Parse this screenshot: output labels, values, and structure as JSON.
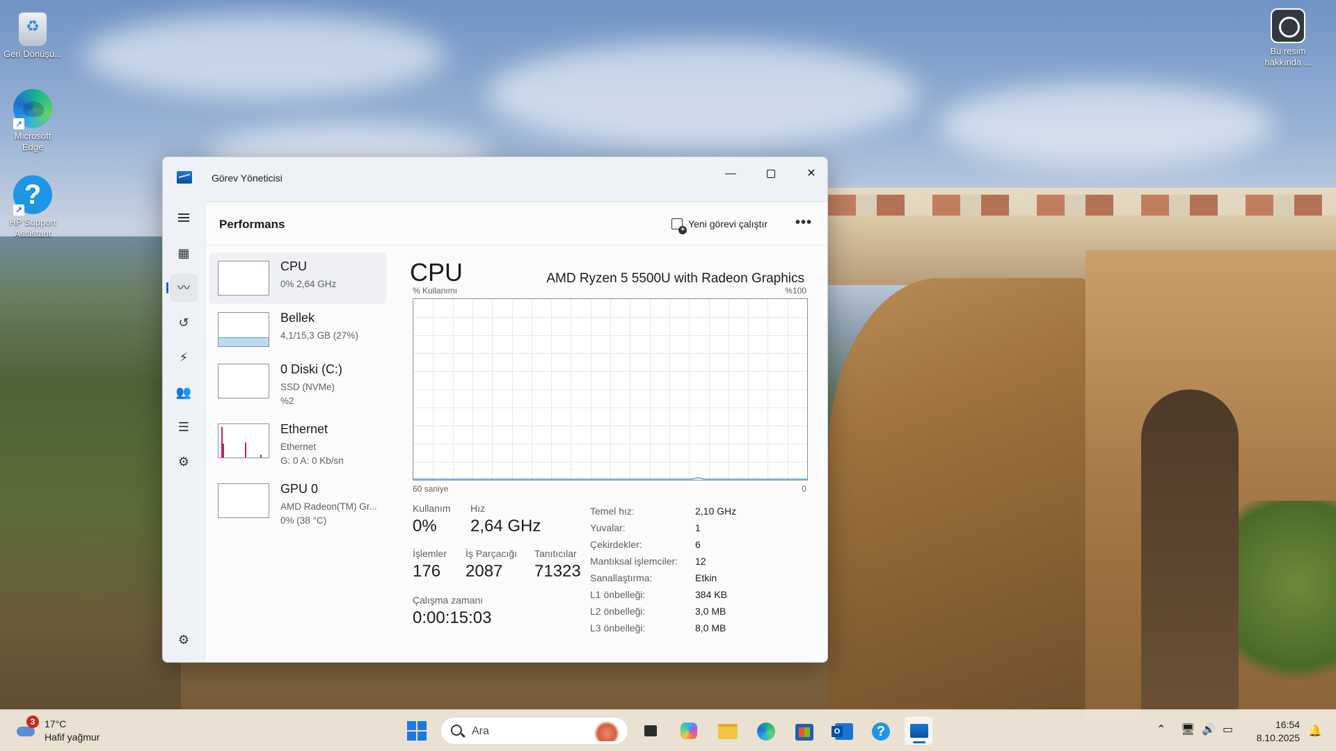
{
  "desktop": {
    "icons": [
      {
        "label": "Geri Dönüşü..."
      },
      {
        "label": "Microsoft Edge"
      },
      {
        "label": "HP Support Assistant"
      },
      {
        "label": "Bu resim hakkında ..."
      }
    ]
  },
  "window": {
    "title": "Görev Yöneticisi",
    "header": {
      "page_title": "Performans",
      "run_task_label": "Yeni görevi çalıştır",
      "more_label": "•••"
    },
    "devices": [
      {
        "name": "CPU",
        "sub1": "0% 2,64 GHz",
        "sub2": ""
      },
      {
        "name": "Bellek",
        "sub1": "4,1/15,3 GB (27%)",
        "sub2": "",
        "usage_fraction": 0.27
      },
      {
        "name": "0 Diski (C:)",
        "sub1": "SSD (NVMe)",
        "sub2": "%2"
      },
      {
        "name": "Ethernet",
        "sub1": "Ethernet",
        "sub2": "G: 0 A: 0 Kb/sn"
      },
      {
        "name": "GPU 0",
        "sub1": "AMD Radeon(TM) Gr...",
        "sub2": "0% (38 °C)"
      }
    ],
    "detail": {
      "title": "CPU",
      "model": "AMD Ryzen 5 5500U with Radeon Graphics",
      "y_label": "% Kullanımı",
      "y_max_label": "%100",
      "x_left_label": "60 saniye",
      "x_right_label": "0",
      "stats": {
        "usage_label": "Kullanım",
        "usage_value": "0%",
        "speed_label": "Hız",
        "speed_value": "2,64 GHz",
        "processes_label": "İşlemler",
        "processes_value": "176",
        "threads_label": "İş Parçacığı",
        "threads_value": "2087",
        "handles_label": "Tanıtıcılar",
        "handles_value": "71323",
        "uptime_label": "Çalışma zamanı",
        "uptime_value": "0:00:15:03"
      },
      "specs": [
        {
          "label": "Temel hız:",
          "value": "2,10 GHz"
        },
        {
          "label": "Yuvalar:",
          "value": "1"
        },
        {
          "label": "Çekirdekler:",
          "value": "6"
        },
        {
          "label": "Mantıksal işlemciler:",
          "value": "12"
        },
        {
          "label": "Sanallaştırma:",
          "value": "Etkin"
        },
        {
          "label": "L1 önbelleği:",
          "value": "384 KB"
        },
        {
          "label": "L2 önbelleği:",
          "value": "3,0 MB"
        },
        {
          "label": "L3 önbelleği:",
          "value": "8,0 MB"
        }
      ]
    }
  },
  "taskbar": {
    "weather": {
      "badge": "3",
      "temp": "17°C",
      "condition": "Hafif yağmur"
    },
    "search_placeholder": "Ara",
    "clock": {
      "time": "16:54",
      "date": "8.10.2025"
    }
  },
  "colors": {
    "accent": "#1a64c8",
    "ethernet": "#c01f6b",
    "memory": "#5da0dc"
  }
}
